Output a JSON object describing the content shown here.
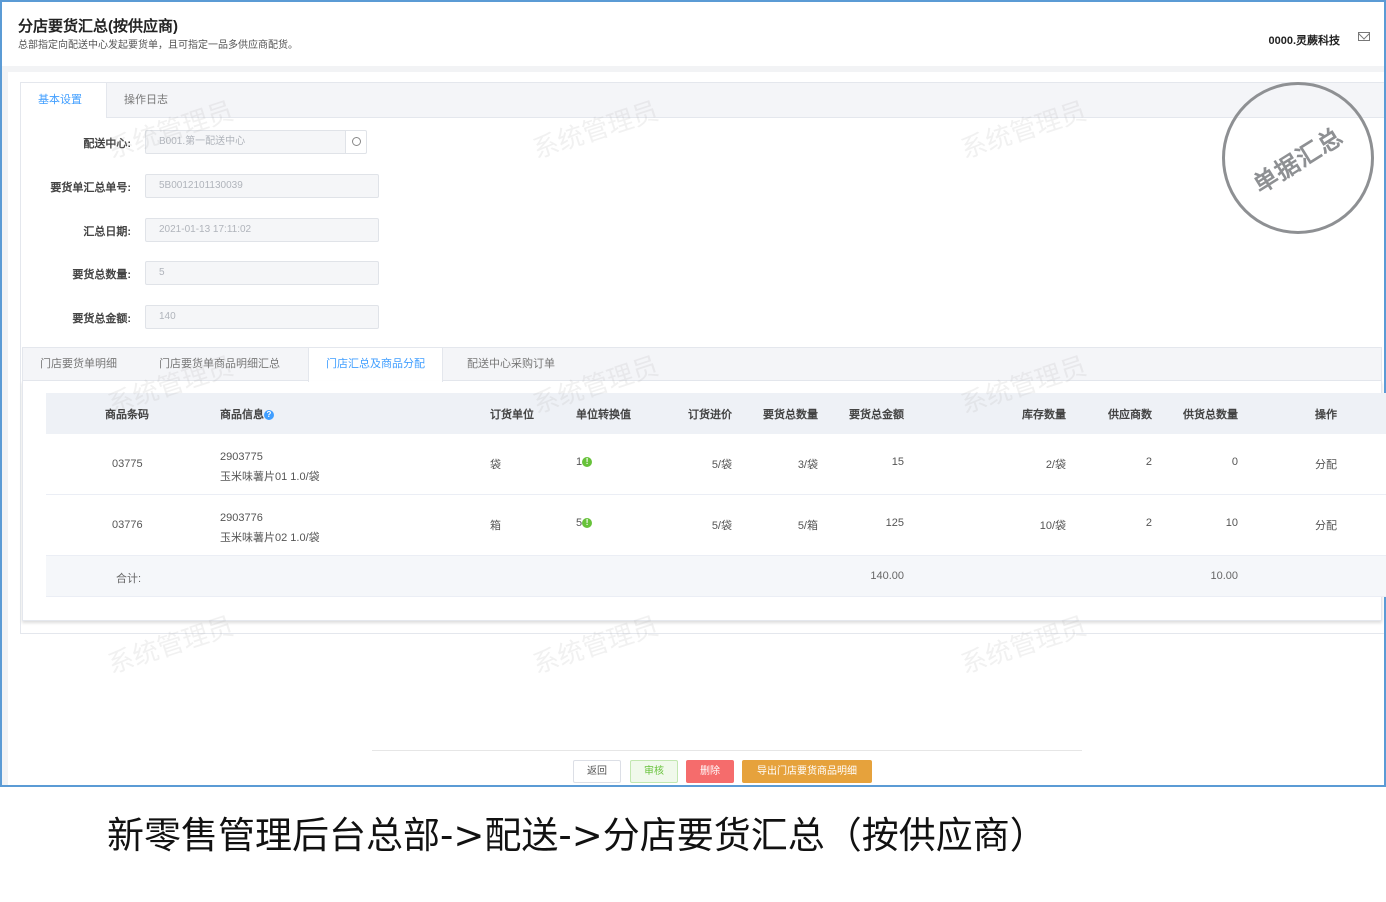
{
  "header": {
    "title": "分店要货汇总(按供应商)",
    "subtitle": "总部指定向配送中心发起要货单，且可指定一品多供应商配货。",
    "user": "0000.灵蕨科技"
  },
  "top_tabs": [
    {
      "label": "基本设置"
    },
    {
      "label": "操作日志"
    }
  ],
  "form": {
    "center_label": "配送中心:",
    "center_value": "B001.第一配送中心",
    "no_label": "要货单汇总单号:",
    "no_value": "5B0012101130039",
    "date_label": "汇总日期:",
    "date_value": "2021-01-13 17:11:02",
    "qty_label": "要货总数量:",
    "qty_value": "5",
    "amount_label": "要货总金额:",
    "amount_value": "140"
  },
  "stamp": "单据汇总",
  "watermark": "系统管理员",
  "detail_tabs": [
    {
      "label": "门店要货单明细"
    },
    {
      "label": "门店要货单商品明细汇总"
    },
    {
      "label": "门店汇总及商品分配"
    },
    {
      "label": "配送中心采购订单"
    }
  ],
  "table": {
    "columns": [
      "商品条码",
      "商品信息",
      "订货单位",
      "单位转换值",
      "订货进价",
      "要货总数量",
      "要货总金额",
      "库存数量",
      "供应商数",
      "供货总数量",
      "操作"
    ],
    "rows": [
      {
        "code": "03775",
        "info_code": "2903775",
        "info_name": "玉米味薯片01 1.0/袋",
        "unit": "袋",
        "conv": "1",
        "price": "5/袋",
        "req_qty": "3/袋",
        "req_amount": "15",
        "stock": "2/袋",
        "suppliers": "2",
        "supply_qty": "0",
        "action": "分配"
      },
      {
        "code": "03776",
        "info_code": "2903776",
        "info_name": "玉米味薯片02 1.0/袋",
        "unit": "箱",
        "conv": "5",
        "price": "5/袋",
        "req_qty": "5/箱",
        "req_amount": "125",
        "stock": "10/袋",
        "suppliers": "2",
        "supply_qty": "10",
        "action": "分配"
      }
    ],
    "footer": {
      "label": "合计:",
      "req_amount": "140.00",
      "supply_qty": "10.00"
    }
  },
  "buttons": {
    "back": "返回",
    "approve": "审核",
    "delete": "删除",
    "export": "导出门店要货商品明细"
  },
  "caption": "新零售管理后台总部->配送->分店要货汇总（按供应商）"
}
